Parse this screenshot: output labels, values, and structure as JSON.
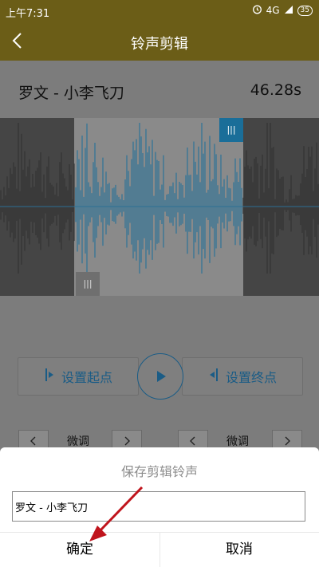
{
  "status_bar": {
    "time": "上午7:31",
    "network": "4G",
    "battery": "35"
  },
  "header": {
    "title": "铃声剪辑"
  },
  "song": {
    "name": "罗文 - 小李飞刀",
    "duration": "46.28s"
  },
  "waveform": {
    "handle_label": "|||"
  },
  "controls": {
    "set_start_label": "设置起点",
    "set_end_label": "设置终点",
    "fine_left_label": "微调",
    "fine_right_label": "微调"
  },
  "dialog": {
    "title": "保存剪辑铃声",
    "input_value": "罗文 - 小李飞刀",
    "confirm_label": "确定",
    "cancel_label": "取消"
  },
  "colors": {
    "accent": "#1a6e99",
    "header": "#6b5d17",
    "annotation": "#c0141c"
  }
}
